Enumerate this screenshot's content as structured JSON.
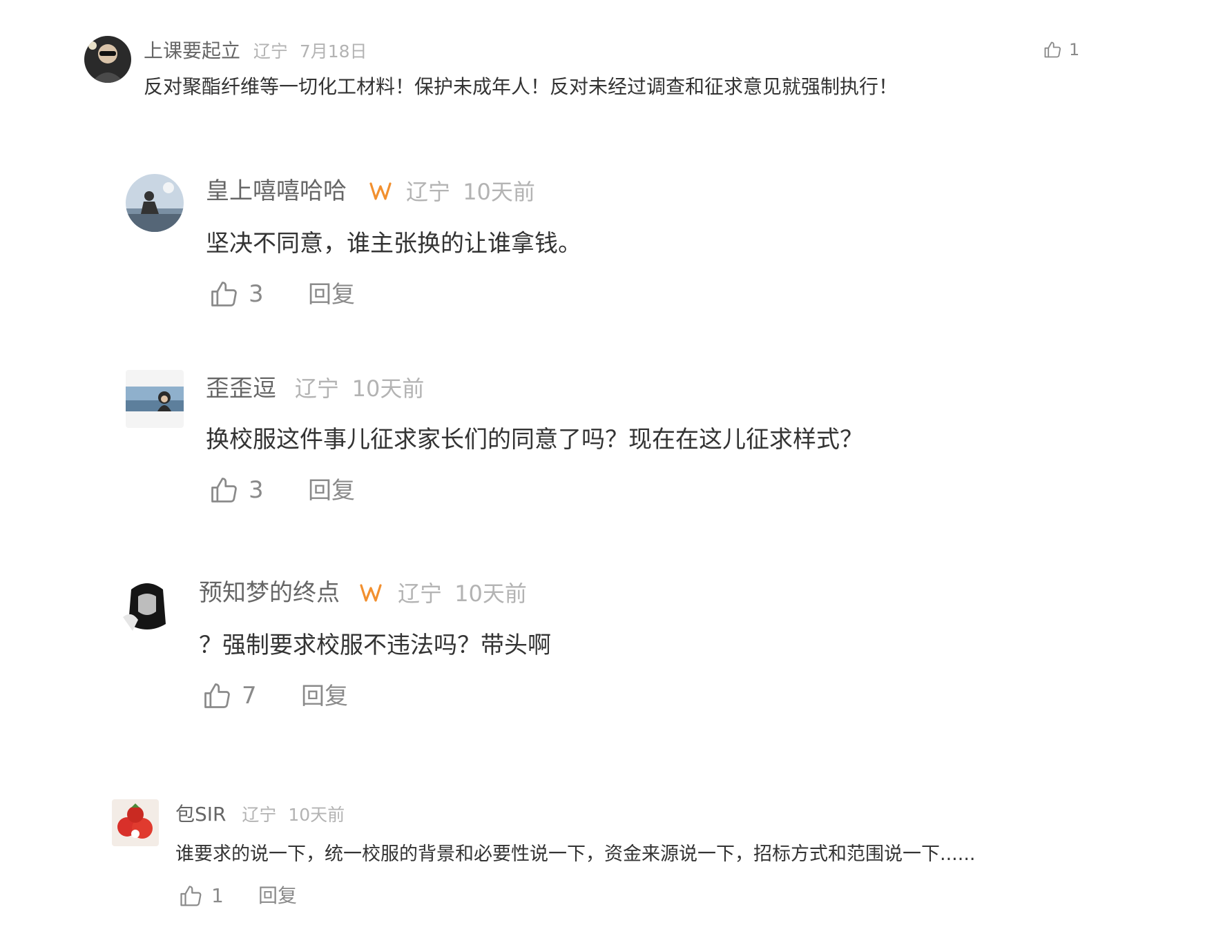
{
  "icons": {
    "like": "thumbs-up-icon",
    "vip": "vip-badge-icon"
  },
  "colors": {
    "vip_badge": "#f2902f",
    "meta_text": "#b3b3b3",
    "action_text": "#8a8a8a"
  },
  "comments": [
    {
      "username": "上课要起立",
      "location": "辽宁",
      "time": "7月18日",
      "text": "反对聚酯纤维等一切化工材料！保护未成年人！反对未经过调查和征求意见就强制执行！",
      "likes": "1",
      "reply_label": "",
      "avatar": "avatar-icon"
    },
    {
      "username": "皇上嘻嘻哈哈",
      "location": "辽宁",
      "time": "10天前",
      "text": "坚决不同意，谁主张换的让谁拿钱。",
      "likes": "3",
      "reply_label": "回复",
      "vip": true,
      "avatar": "avatar-icon"
    },
    {
      "username": "歪歪逗",
      "location": "辽宁",
      "time": "10天前",
      "text": "换校服这件事儿征求家长们的同意了吗？现在在这儿征求样式？",
      "likes": "3",
      "reply_label": "回复",
      "avatar": "avatar-icon"
    },
    {
      "username": "预知梦的终点",
      "location": "辽宁",
      "time": "10天前",
      "text": "？强制要求校服不违法吗？带头啊",
      "likes": "7",
      "reply_label": "回复",
      "vip": true,
      "avatar": "avatar-icon"
    },
    {
      "username": "包SIR",
      "location": "辽宁",
      "time": "10天前",
      "text": "谁要求的说一下，统一校服的背景和必要性说一下，资金来源说一下，招标方式和范围说一下......",
      "likes": "1",
      "reply_label": "回复",
      "avatar": "avatar-icon"
    }
  ]
}
